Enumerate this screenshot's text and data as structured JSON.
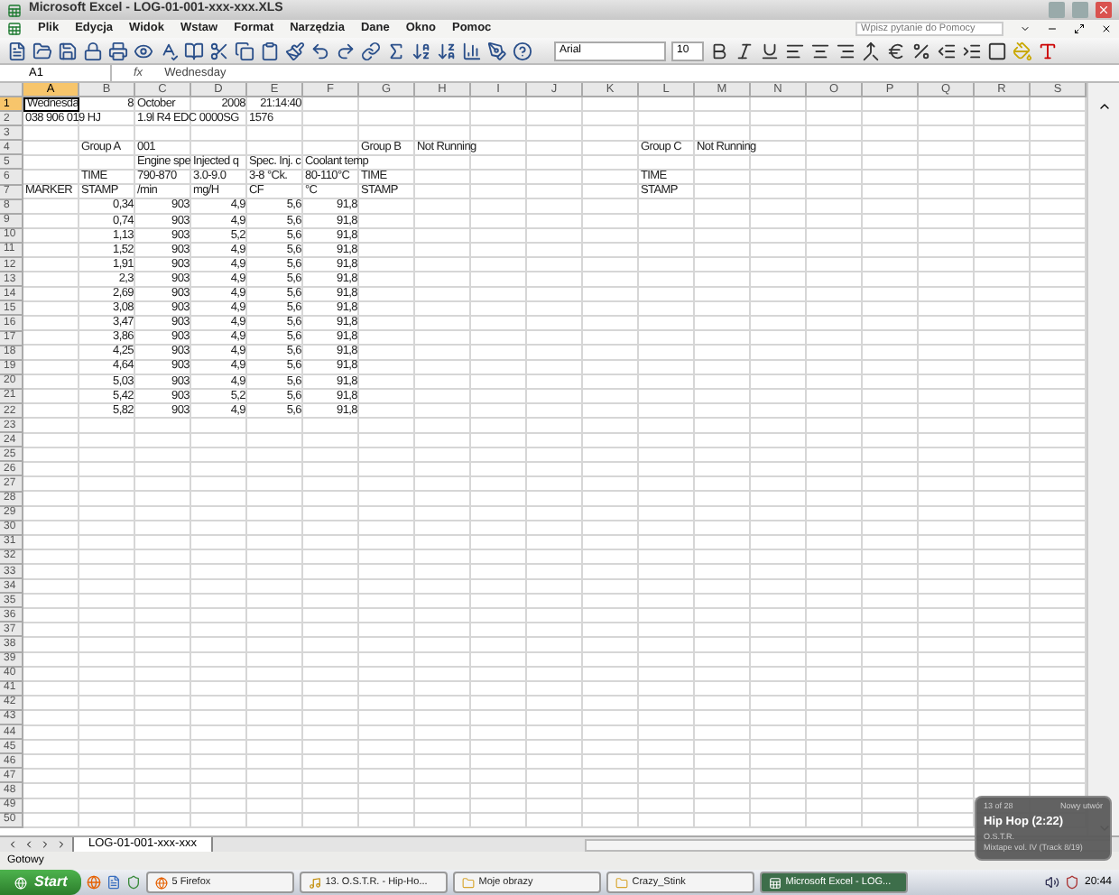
{
  "window": {
    "title": "Microsoft Excel - LOG-01-001-xxx-xxx.XLS"
  },
  "menu": [
    "Plik",
    "Edycja",
    "Widok",
    "Wstaw",
    "Format",
    "Narzędzia",
    "Dane",
    "Okno",
    "Pomoc"
  ],
  "help_box": {
    "placeholder": "Wpisz pytanie do Pomocy"
  },
  "font_box": {
    "value": "Arial"
  },
  "size_box": {
    "value": "10"
  },
  "formula_bar": {
    "name_box": "A1",
    "fx": "fx",
    "value": "Wednesday"
  },
  "columns": [
    "A",
    "B",
    "C",
    "D",
    "E",
    "F",
    "G",
    "H",
    "I",
    "J",
    "K",
    "L",
    "M",
    "N",
    "O",
    "P",
    "Q",
    "R",
    "S"
  ],
  "rows": [
    {
      "header": "1",
      "cells": [
        {
          "text": "Wednesda",
          "kind": "text",
          "selected": true
        },
        {
          "text": "8",
          "kind": "number"
        },
        {
          "text": "October",
          "kind": "text"
        },
        {
          "text": "2008",
          "kind": "number"
        },
        {
          "text": "21:14:40",
          "kind": "number"
        }
      ]
    },
    {
      "header": "2",
      "cells": [
        {
          "text": "038 906 019 HJ",
          "kind": "text"
        },
        null,
        {
          "text": "1.9l R4 EDC 0000SG",
          "kind": "text"
        },
        null,
        {
          "text": "1576",
          "kind": "text"
        }
      ]
    },
    {
      "header": "3"
    },
    {
      "header": "4",
      "cells": [
        null,
        {
          "text": "Group A",
          "kind": "text"
        },
        {
          "text": "001",
          "kind": "text"
        },
        null,
        null,
        null,
        {
          "text": "Group B",
          "kind": "text"
        },
        {
          "text": "Not Running",
          "kind": "text"
        },
        null,
        null,
        null,
        {
          "text": "Group C",
          "kind": "text"
        },
        {
          "text": "Not Running",
          "kind": "text"
        }
      ]
    },
    {
      "header": "5",
      "cells": [
        null,
        null,
        {
          "text": "Engine spe",
          "kind": "text"
        },
        {
          "text": "Injected q",
          "kind": "text"
        },
        {
          "text": "Spec. Inj. c",
          "kind": "text"
        },
        {
          "text": "Coolant temp",
          "kind": "text"
        }
      ]
    },
    {
      "header": "6",
      "cells": [
        null,
        {
          "text": "TIME",
          "kind": "text"
        },
        {
          "text": "790-870",
          "kind": "text"
        },
        {
          "text": "3.0-9.0",
          "kind": "text"
        },
        {
          "text": "3-8 °Ck.",
          "kind": "text"
        },
        {
          "text": "80-110°C",
          "kind": "text"
        },
        {
          "text": "TIME",
          "kind": "text"
        },
        null,
        null,
        null,
        null,
        {
          "text": "TIME",
          "kind": "text"
        }
      ]
    },
    {
      "header": "7",
      "cells": [
        {
          "text": "MARKER",
          "kind": "text"
        },
        {
          "text": "STAMP",
          "kind": "text"
        },
        {
          "text": "/min",
          "kind": "text"
        },
        {
          "text": "mg/H",
          "kind": "text"
        },
        {
          "text": "CF",
          "kind": "text"
        },
        {
          "text": "°C",
          "kind": "text"
        },
        {
          "text": "STAMP",
          "kind": "text"
        },
        null,
        null,
        null,
        null,
        {
          "text": "STAMP",
          "kind": "text"
        }
      ]
    },
    {
      "header": "8",
      "cells": [
        null,
        {
          "text": "0,34",
          "kind": "number"
        },
        {
          "text": "903",
          "kind": "number"
        },
        {
          "text": "4,9",
          "kind": "number"
        },
        {
          "text": "5,6",
          "kind": "number"
        },
        {
          "text": "91,8",
          "kind": "number"
        }
      ]
    },
    {
      "header": "9",
      "cells": [
        null,
        {
          "text": "0,74",
          "kind": "number"
        },
        {
          "text": "903",
          "kind": "number"
        },
        {
          "text": "4,9",
          "kind": "number"
        },
        {
          "text": "5,6",
          "kind": "number"
        },
        {
          "text": "91,8",
          "kind": "number"
        }
      ]
    },
    {
      "header": "10",
      "cells": [
        null,
        {
          "text": "1,13",
          "kind": "number"
        },
        {
          "text": "903",
          "kind": "number"
        },
        {
          "text": "5,2",
          "kind": "number"
        },
        {
          "text": "5,6",
          "kind": "number"
        },
        {
          "text": "91,8",
          "kind": "number"
        }
      ]
    },
    {
      "header": "11",
      "cells": [
        null,
        {
          "text": "1,52",
          "kind": "number"
        },
        {
          "text": "903",
          "kind": "number"
        },
        {
          "text": "4,9",
          "kind": "number"
        },
        {
          "text": "5,6",
          "kind": "number"
        },
        {
          "text": "91,8",
          "kind": "number"
        }
      ]
    },
    {
      "header": "12",
      "cells": [
        null,
        {
          "text": "1,91",
          "kind": "number"
        },
        {
          "text": "903",
          "kind": "number"
        },
        {
          "text": "4,9",
          "kind": "number"
        },
        {
          "text": "5,6",
          "kind": "number"
        },
        {
          "text": "91,8",
          "kind": "number"
        }
      ]
    },
    {
      "header": "13",
      "cells": [
        null,
        {
          "text": "2,3",
          "kind": "number"
        },
        {
          "text": "903",
          "kind": "number"
        },
        {
          "text": "4,9",
          "kind": "number"
        },
        {
          "text": "5,6",
          "kind": "number"
        },
        {
          "text": "91,8",
          "kind": "number"
        }
      ]
    },
    {
      "header": "14",
      "cells": [
        null,
        {
          "text": "2,69",
          "kind": "number"
        },
        {
          "text": "903",
          "kind": "number"
        },
        {
          "text": "4,9",
          "kind": "number"
        },
        {
          "text": "5,6",
          "kind": "number"
        },
        {
          "text": "91,8",
          "kind": "number"
        }
      ]
    },
    {
      "header": "15",
      "cells": [
        null,
        {
          "text": "3,08",
          "kind": "number"
        },
        {
          "text": "903",
          "kind": "number"
        },
        {
          "text": "4,9",
          "kind": "number"
        },
        {
          "text": "5,6",
          "kind": "number"
        },
        {
          "text": "91,8",
          "kind": "number"
        }
      ]
    },
    {
      "header": "16",
      "cells": [
        null,
        {
          "text": "3,47",
          "kind": "number"
        },
        {
          "text": "903",
          "kind": "number"
        },
        {
          "text": "4,9",
          "kind": "number"
        },
        {
          "text": "5,6",
          "kind": "number"
        },
        {
          "text": "91,8",
          "kind": "number"
        }
      ]
    },
    {
      "header": "17",
      "cells": [
        null,
        {
          "text": "3,86",
          "kind": "number"
        },
        {
          "text": "903",
          "kind": "number"
        },
        {
          "text": "4,9",
          "kind": "number"
        },
        {
          "text": "5,6",
          "kind": "number"
        },
        {
          "text": "91,8",
          "kind": "number"
        }
      ]
    },
    {
      "header": "18",
      "cells": [
        null,
        {
          "text": "4,25",
          "kind": "number"
        },
        {
          "text": "903",
          "kind": "number"
        },
        {
          "text": "4,9",
          "kind": "number"
        },
        {
          "text": "5,6",
          "kind": "number"
        },
        {
          "text": "91,8",
          "kind": "number"
        }
      ]
    },
    {
      "header": "19",
      "cells": [
        null,
        {
          "text": "4,64",
          "kind": "number"
        },
        {
          "text": "903",
          "kind": "number"
        },
        {
          "text": "4,9",
          "kind": "number"
        },
        {
          "text": "5,6",
          "kind": "number"
        },
        {
          "text": "91,8",
          "kind": "number"
        }
      ]
    },
    {
      "header": "20",
      "cells": [
        null,
        {
          "text": "5,03",
          "kind": "number"
        },
        {
          "text": "903",
          "kind": "number"
        },
        {
          "text": "4,9",
          "kind": "number"
        },
        {
          "text": "5,6",
          "kind": "number"
        },
        {
          "text": "91,8",
          "kind": "number"
        }
      ]
    },
    {
      "header": "21",
      "cells": [
        null,
        {
          "text": "5,42",
          "kind": "number"
        },
        {
          "text": "903",
          "kind": "number"
        },
        {
          "text": "5,2",
          "kind": "number"
        },
        {
          "text": "5,6",
          "kind": "number"
        },
        {
          "text": "91,8",
          "kind": "number"
        }
      ]
    },
    {
      "header": "22",
      "cells": [
        null,
        {
          "text": "5,82",
          "kind": "number"
        },
        {
          "text": "903",
          "kind": "number"
        },
        {
          "text": "4,9",
          "kind": "number"
        },
        {
          "text": "5,6",
          "kind": "number"
        },
        {
          "text": "91,8",
          "kind": "number"
        }
      ]
    },
    {
      "header": "23"
    },
    {
      "header": "24"
    },
    {
      "header": "25"
    },
    {
      "header": "26"
    },
    {
      "header": "27"
    },
    {
      "header": "28"
    },
    {
      "header": "29"
    },
    {
      "header": "30"
    },
    {
      "header": "31"
    },
    {
      "header": "32"
    },
    {
      "header": "33"
    },
    {
      "header": "34"
    },
    {
      "header": "35"
    },
    {
      "header": "36"
    },
    {
      "header": "37"
    },
    {
      "header": "38"
    },
    {
      "header": "39"
    },
    {
      "header": "40"
    },
    {
      "header": "41"
    },
    {
      "header": "42"
    },
    {
      "header": "43"
    },
    {
      "header": "44"
    },
    {
      "header": "45"
    },
    {
      "header": "46"
    },
    {
      "header": "47"
    },
    {
      "header": "48"
    },
    {
      "header": "49"
    },
    {
      "header": "50"
    }
  ],
  "sheet_tabs": [
    {
      "label": "LOG-01-001-xxx-xxx",
      "selected": true
    }
  ],
  "status_bar": "Gotowy",
  "notification": {
    "counter": "13 of 28",
    "heading": "Nowy utwór",
    "track": "Hip Hop (2:22)",
    "artist": "O.S.T.R.",
    "album": "Mixtape vol. IV (Track 8/19)"
  },
  "taskbar": {
    "start": "Start",
    "tasks": [
      {
        "label": "5 Firefox",
        "kind": "browser",
        "selected": false
      },
      {
        "label": "13. O.S.T.R. - Hip-Ho...",
        "kind": "music",
        "selected": false
      },
      {
        "label": "Moje obrazy",
        "kind": "folder",
        "selected": false
      },
      {
        "label": "Crazy_Stink",
        "kind": "folder",
        "selected": false
      },
      {
        "label": "Microsoft Excel - LOG...",
        "kind": "sheet",
        "selected": true
      }
    ],
    "clock": "20:44"
  }
}
